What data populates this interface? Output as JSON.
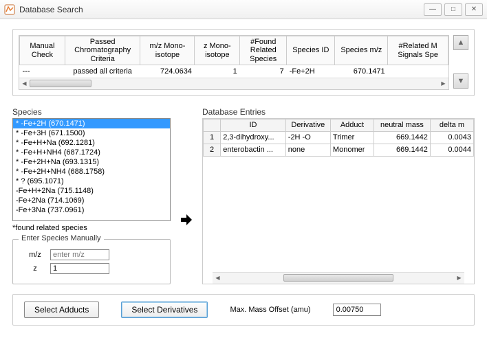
{
  "window": {
    "title": "Database Search"
  },
  "topgrid": {
    "headers": [
      "Manual Check",
      "Passed Chromatography Criteria",
      "m/z Mono-isotope",
      "z Mono-isotope",
      "#Found Related Species",
      "Species ID",
      "Species m/z",
      "#Related M Signals Spe"
    ],
    "row": {
      "manual": "---",
      "passed": "passed all criteria",
      "mz_mono": "724.0634",
      "z_mono": "1",
      "nfound": "7",
      "species_id": "-Fe+2H",
      "species_mz": "670.1471",
      "related": ""
    }
  },
  "species": {
    "label": "Species",
    "items": [
      "* -Fe+2H (670.1471)",
      "* -Fe+3H (671.1500)",
      "* -Fe+H+Na (692.1281)",
      "* -Fe+H+NH4 (687.1724)",
      "* -Fe+2H+Na (693.1315)",
      "* -Fe+2H+NH4 (688.1758)",
      "* ? (695.1071)",
      "-Fe+H+2Na (715.1148)",
      "-Fe+2Na (714.1069)",
      "-Fe+3Na (737.0961)"
    ],
    "selected_index": 0,
    "footnote": "*found related species"
  },
  "manual_entry": {
    "legend": "Enter Species Manually",
    "mz_label": "m/z",
    "mz_placeholder": "enter m/z",
    "mz_value": "",
    "z_label": "z",
    "z_value": "1"
  },
  "db": {
    "label": "Database Entries",
    "headers": [
      "",
      "ID",
      "Derivative",
      "Adduct",
      "neutral mass",
      "delta m"
    ],
    "rows": [
      {
        "n": "1",
        "id": "2,3-dihydroxy...",
        "deriv": "-2H -O",
        "adduct": "Trimer",
        "mass": "669.1442",
        "dm": "0.0043"
      },
      {
        "n": "2",
        "id": "enterobactin ...",
        "deriv": "none",
        "adduct": "Monomer",
        "mass": "669.1442",
        "dm": "0.0044"
      }
    ]
  },
  "bottom": {
    "adducts": "Select Adducts",
    "derivatives": "Select Derivatives",
    "offset_label": "Max. Mass Offset (amu)",
    "offset_value": "0.00750"
  }
}
